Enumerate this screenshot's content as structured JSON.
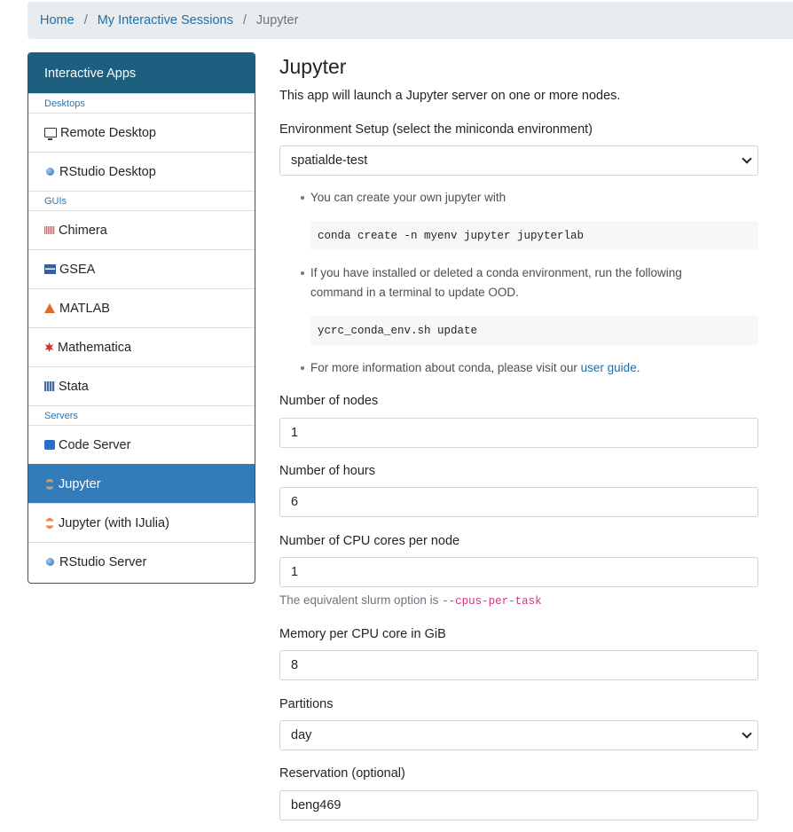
{
  "breadcrumb": {
    "home": "Home",
    "sessions": "My Interactive Sessions",
    "current": "Jupyter",
    "separator": "/"
  },
  "sidebar": {
    "title": "Interactive Apps",
    "sections": {
      "desktops": "Desktops",
      "guis": "GUIs",
      "servers": "Servers"
    },
    "items": {
      "remote_desktop": "Remote Desktop",
      "rstudio_desktop": "RStudio Desktop",
      "chimera": "Chimera",
      "gsea": "GSEA",
      "matlab": "MATLAB",
      "mathematica": "Mathematica",
      "stata": "Stata",
      "code_server": "Code Server",
      "jupyter": "Jupyter",
      "jupyter_ijulia": "Jupyter (with IJulia)",
      "rstudio_server": "RStudio Server"
    }
  },
  "main": {
    "title": "Jupyter",
    "description": "This app will launch a Jupyter server on one or more nodes.",
    "env_label": "Environment Setup (select the miniconda environment)",
    "env_value": "spatialde-test",
    "tip1": "You can create your own jupyter with",
    "code1": "conda create -n myenv jupyter jupyterlab",
    "tip2_line1": "If you have installed or deleted a conda environment, run the following",
    "tip2_line2": "command in a terminal to update OOD.",
    "code2": "ycrc_conda_env.sh update",
    "tip3_prefix": "For more information about conda, please visit our ",
    "tip3_link": "user guide",
    "tip3_suffix": ".",
    "nodes_label": "Number of nodes",
    "nodes_value": "1",
    "hours_label": "Number of hours",
    "hours_value": "6",
    "cpus_label": "Number of CPU cores per node",
    "cpus_value": "1",
    "cpus_help_prefix": "The equivalent slurm option is ",
    "cpus_help_code": "--cpus-per-task",
    "mem_label": "Memory per CPU core in GiB",
    "mem_value": "8",
    "partition_label": "Partitions",
    "partition_value": "day",
    "reservation_label": "Reservation (optional)",
    "reservation_value": "beng469"
  },
  "colors": {
    "sidebar_header": "#1c5f7e",
    "active_item": "#327cb9",
    "link": "#1f6ea8",
    "code_inline": "#d63384"
  }
}
